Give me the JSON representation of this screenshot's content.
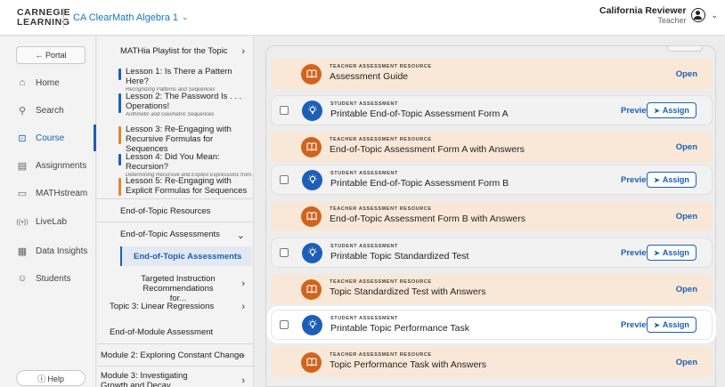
{
  "header": {
    "logo_line1": "CARNEGIE",
    "logo_line2": "LEARNING",
    "course": "CA ClearMath Algebra 1",
    "course_chevron": "chevron-down-icon",
    "user_name": "California Reviewer",
    "user_role": "Teacher"
  },
  "rail": {
    "portal": "← Portal",
    "items": [
      {
        "label": "Home",
        "icon": "home-icon"
      },
      {
        "label": "Search",
        "icon": "search-icon"
      },
      {
        "label": "Course",
        "icon": "course-icon"
      },
      {
        "label": "Assignments",
        "icon": "assignments-icon"
      },
      {
        "label": "MATHstream",
        "icon": "mathstream-icon"
      },
      {
        "label": "LiveLab",
        "icon": "livelab-icon"
      },
      {
        "label": "Data Insights",
        "icon": "data-insights-icon"
      },
      {
        "label": "Students",
        "icon": "students-icon"
      }
    ],
    "help": "ⓘ Help"
  },
  "nav": {
    "playlist": "MATHia Playlist for the Topic",
    "lessons": [
      {
        "title": "Lesson 1: Is There a Pattern Here?",
        "sub": "Recognizing Patterns and Sequences",
        "color": "#1d5fb8"
      },
      {
        "title": "Lesson 2: The Password Is . . . Operations!",
        "sub": "Arithmetic and Geometric Sequences",
        "color": "#1d5fb8"
      },
      {
        "title": "Lesson 3: Re-Engaging with Recursive Formulas for Sequences",
        "sub": "",
        "color": "#e0872c"
      },
      {
        "title": "Lesson 4: Did You Mean: Recursion?",
        "sub": "Determining Recursive and Explicit Expressions from...",
        "color": "#1d5fb8"
      },
      {
        "title": "Lesson 5: Re-Engaging with Explicit Formulas for Sequences",
        "sub": "",
        "color": "#e0872c"
      }
    ],
    "resources": "End-of-Topic Resources",
    "assessments": "End-of-Topic Assessments",
    "assessments_sub": "End-of-Topic Assessments",
    "targeted": "Targeted Instruction Recommendations for...",
    "topic3": "Topic 3: Linear Regressions",
    "module_assessment": "End-of-Module Assessment",
    "module2": "Module 2: Exploring Constant Change",
    "module3": "Module 3: Investigating Growth and Decay"
  },
  "cards": [
    {
      "kind": "TEACHER ASSESSMENT RESOURCE",
      "title": "Assessment Guide",
      "type": "teacher"
    },
    {
      "kind": "STUDENT ASSESSMENT",
      "title": "Printable End-of-Topic Assessment Form A",
      "type": "student"
    },
    {
      "kind": "TEACHER ASSESSMENT RESOURCE",
      "title": "End-of-Topic Assessment Form A with Answers",
      "type": "teacher"
    },
    {
      "kind": "STUDENT ASSESSMENT",
      "title": "Printable End-of-Topic Assessment Form B",
      "type": "student"
    },
    {
      "kind": "TEACHER ASSESSMENT RESOURCE",
      "title": "End-of-Topic Assessment Form B with Answers",
      "type": "teacher"
    },
    {
      "kind": "STUDENT ASSESSMENT",
      "title": "Printable Topic Standardized Test",
      "type": "student"
    },
    {
      "kind": "TEACHER ASSESSMENT RESOURCE",
      "title": "Topic Standardized Test with Answers",
      "type": "teacher"
    },
    {
      "kind": "STUDENT ASSESSMENT",
      "title": "Printable Topic Performance Task",
      "type": "student"
    },
    {
      "kind": "TEACHER ASSESSMENT RESOURCE",
      "title": "Topic Performance Task with Answers",
      "type": "teacher"
    }
  ],
  "actions": {
    "open": "Open",
    "preview": "Preview",
    "assign": "Assign"
  },
  "colors": {
    "accent": "#1a5fb4",
    "teacher_icon": "#d0641f",
    "student_icon": "#1d5fb8",
    "teacher_bg": "#f9e8d8"
  }
}
